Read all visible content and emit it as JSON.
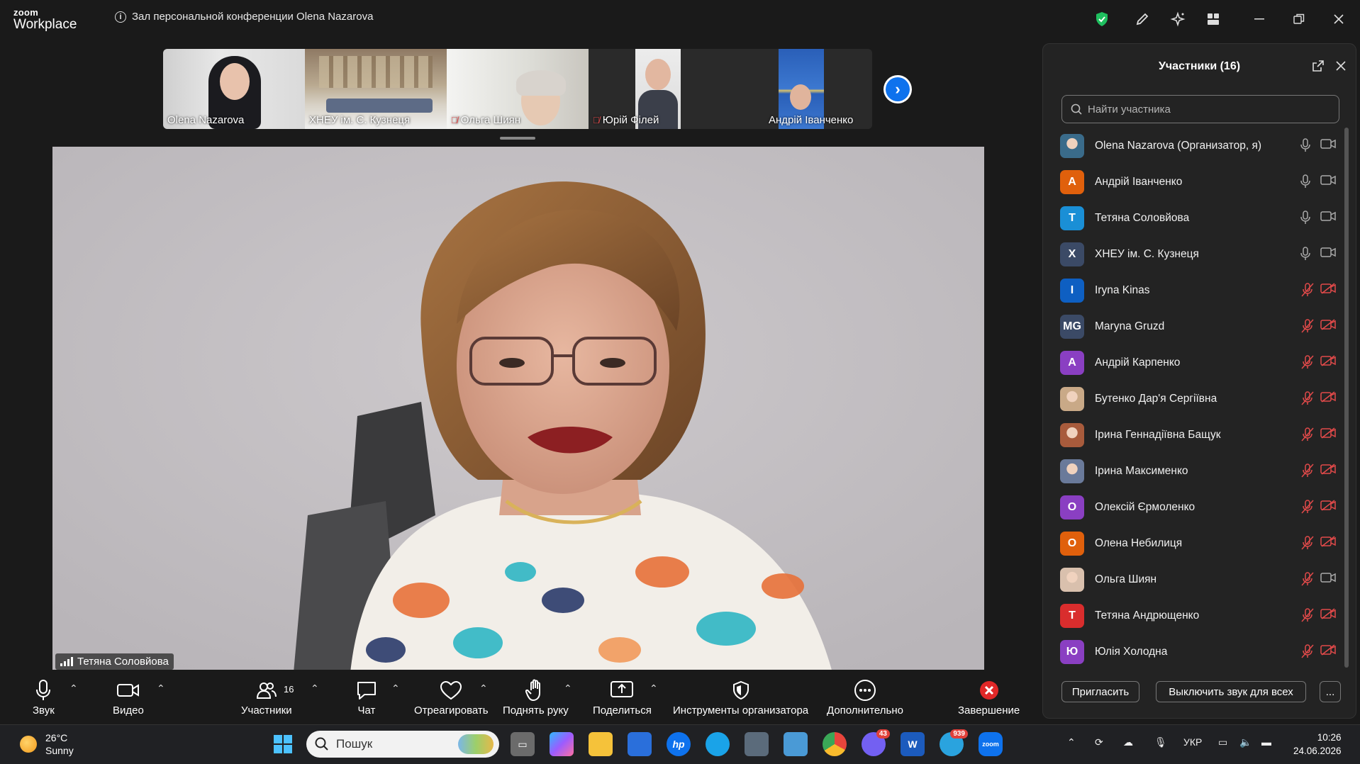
{
  "app": {
    "brand_small": "zoom",
    "brand_big": "Workplace"
  },
  "meeting": {
    "title": "Зал персональной конференции Olena Nazarova"
  },
  "strip": {
    "thumbnails": [
      {
        "name": "Olena Nazarova",
        "muted": false
      },
      {
        "name": "ХНЕУ ім. С. Кузнеця",
        "muted": false
      },
      {
        "name": "Ольга Шиян",
        "muted": true
      },
      {
        "name": "Юрій Філей",
        "muted": true
      },
      {
        "name": "Андрій Іванченко",
        "muted": false
      }
    ]
  },
  "main_video": {
    "speaker": "Тетяна Соловйова"
  },
  "toolbar": {
    "audio": "Звук",
    "video": "Видео",
    "participants": "Участники",
    "participants_count": "16",
    "chat": "Чат",
    "react": "Отреагировать",
    "raise_hand": "Поднять руку",
    "share": "Поделиться",
    "host_tools": "Инструменты организатора",
    "more": "Дополнительно",
    "end": "Завершение"
  },
  "panel": {
    "title": "Участники (16)",
    "search_placeholder": "Найти участника",
    "invite": "Пригласить",
    "mute_all": "Выключить звук для всех",
    "more": "...",
    "participants": [
      {
        "name": "Olena Nazarova (Организатор, я)",
        "avatar": "",
        "color": "#3a6b8a",
        "photo": true,
        "mic": "on",
        "cam": "on"
      },
      {
        "name": "Андрій Іванченко",
        "avatar": "A",
        "color": "#e0600c",
        "photo": false,
        "mic": "on",
        "cam": "on"
      },
      {
        "name": "Тетяна Соловйова",
        "avatar": "T",
        "color": "#1a8fd6",
        "photo": false,
        "mic": "on",
        "cam": "on"
      },
      {
        "name": "ХНЕУ ім. С. Кузнеця",
        "avatar": "X",
        "color": "#3b4a66",
        "photo": false,
        "mic": "on",
        "cam": "on"
      },
      {
        "name": "Iryna Kinas",
        "avatar": "I",
        "color": "#0e5fc2",
        "photo": false,
        "mic": "off",
        "cam": "off"
      },
      {
        "name": "Maryna Gruzd",
        "avatar": "MG",
        "color": "#3b4a66",
        "photo": false,
        "mic": "off",
        "cam": "off"
      },
      {
        "name": "Андрій Карпенко",
        "avatar": "A",
        "color": "#8a3fc2",
        "photo": false,
        "mic": "off",
        "cam": "off"
      },
      {
        "name": "Бутенко Дар'я Сергіївна",
        "avatar": "",
        "color": "#c9a987",
        "photo": true,
        "mic": "off",
        "cam": "off"
      },
      {
        "name": "Ірина Геннадіївна Бащук",
        "avatar": "",
        "color": "#a85b3c",
        "photo": true,
        "mic": "off",
        "cam": "off"
      },
      {
        "name": "Ірина Максименко",
        "avatar": "",
        "color": "#6a7a9a",
        "photo": true,
        "mic": "off",
        "cam": "off"
      },
      {
        "name": "Олексій Єрмоленко",
        "avatar": "O",
        "color": "#8a3fc2",
        "photo": false,
        "mic": "off",
        "cam": "off"
      },
      {
        "name": "Олена Небилиця",
        "avatar": "O",
        "color": "#e0600c",
        "photo": false,
        "mic": "off",
        "cam": "off"
      },
      {
        "name": "Ольга Шиян",
        "avatar": "",
        "color": "#d9c0ad",
        "photo": true,
        "mic": "off",
        "cam": "on"
      },
      {
        "name": "Тетяна Андрющенко",
        "avatar": "T",
        "color": "#d92d2d",
        "photo": false,
        "mic": "off",
        "cam": "off"
      },
      {
        "name": "Юлія Холодна",
        "avatar": "Ю",
        "color": "#8a3fc2",
        "photo": false,
        "mic": "off",
        "cam": "off"
      }
    ]
  },
  "taskbar": {
    "weather_temp": "26°C",
    "weather_desc": "Sunny",
    "search_placeholder": "Пошук",
    "viber_badge": "43",
    "telegram_badge": "939",
    "language": "УКР",
    "time": "10:26",
    "date": "24.06.2026"
  },
  "colors": {
    "accent": "#0e72ed",
    "end": "#e02828",
    "muted": "#e24a4a",
    "shield": "#1fbf5f"
  }
}
